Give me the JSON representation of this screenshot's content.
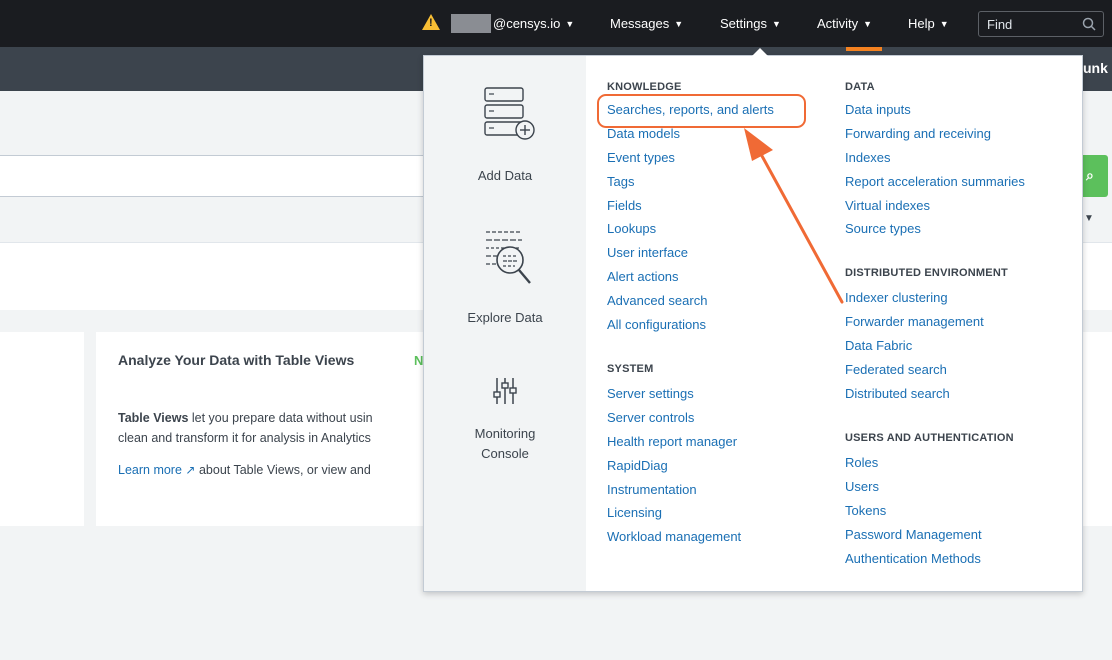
{
  "topbar": {
    "user": "@censys.io",
    "messages": "Messages",
    "settings": "Settings",
    "activity": "Activity",
    "help": "Help",
    "find_placeholder": "Find",
    "warning": "!"
  },
  "appbar": {
    "brand": "unk"
  },
  "background": {
    "card_title": "Analyze Your Data with Table Views",
    "card_badge": "N",
    "line1_bold": "Table Views",
    "line1_rest": " let you prepare data without usin",
    "line2": "clean and transform it for analysis in Analytics",
    "learn_more": "Learn more",
    "line3_rest": " about Table Views, or view and"
  },
  "quick_links": [
    {
      "label": "Add Data",
      "icon": "add-data-icon"
    },
    {
      "label": "Explore Data",
      "icon": "explore-data-icon"
    },
    {
      "label": "Monitoring Console",
      "icon": "monitoring-console-icon"
    }
  ],
  "knowledge": {
    "title": "KNOWLEDGE",
    "items": [
      "Searches, reports, and alerts",
      "Data models",
      "Event types",
      "Tags",
      "Fields",
      "Lookups",
      "User interface",
      "Alert actions",
      "Advanced search",
      "All configurations"
    ]
  },
  "system": {
    "title": "SYSTEM",
    "items": [
      "Server settings",
      "Server controls",
      "Health report manager",
      "RapidDiag",
      "Instrumentation",
      "Licensing",
      "Workload management"
    ]
  },
  "data": {
    "title": "DATA",
    "items": [
      "Data inputs",
      "Forwarding and receiving",
      "Indexes",
      "Report acceleration summaries",
      "Virtual indexes",
      "Source types"
    ]
  },
  "distributed": {
    "title": "DISTRIBUTED ENVIRONMENT",
    "items": [
      "Indexer clustering",
      "Forwarder management",
      "Data Fabric",
      "Federated search",
      "Distributed search"
    ]
  },
  "users": {
    "title": "USERS AND AUTHENTICATION",
    "items": [
      "Roles",
      "Users",
      "Tokens",
      "Password Management",
      "Authentication Methods"
    ]
  },
  "colors": {
    "link": "#1a6fb4",
    "annotation": "#f06a35",
    "topbar": "#1a1c20",
    "appbar": "#3c444d",
    "search_button": "#5cc05c"
  }
}
